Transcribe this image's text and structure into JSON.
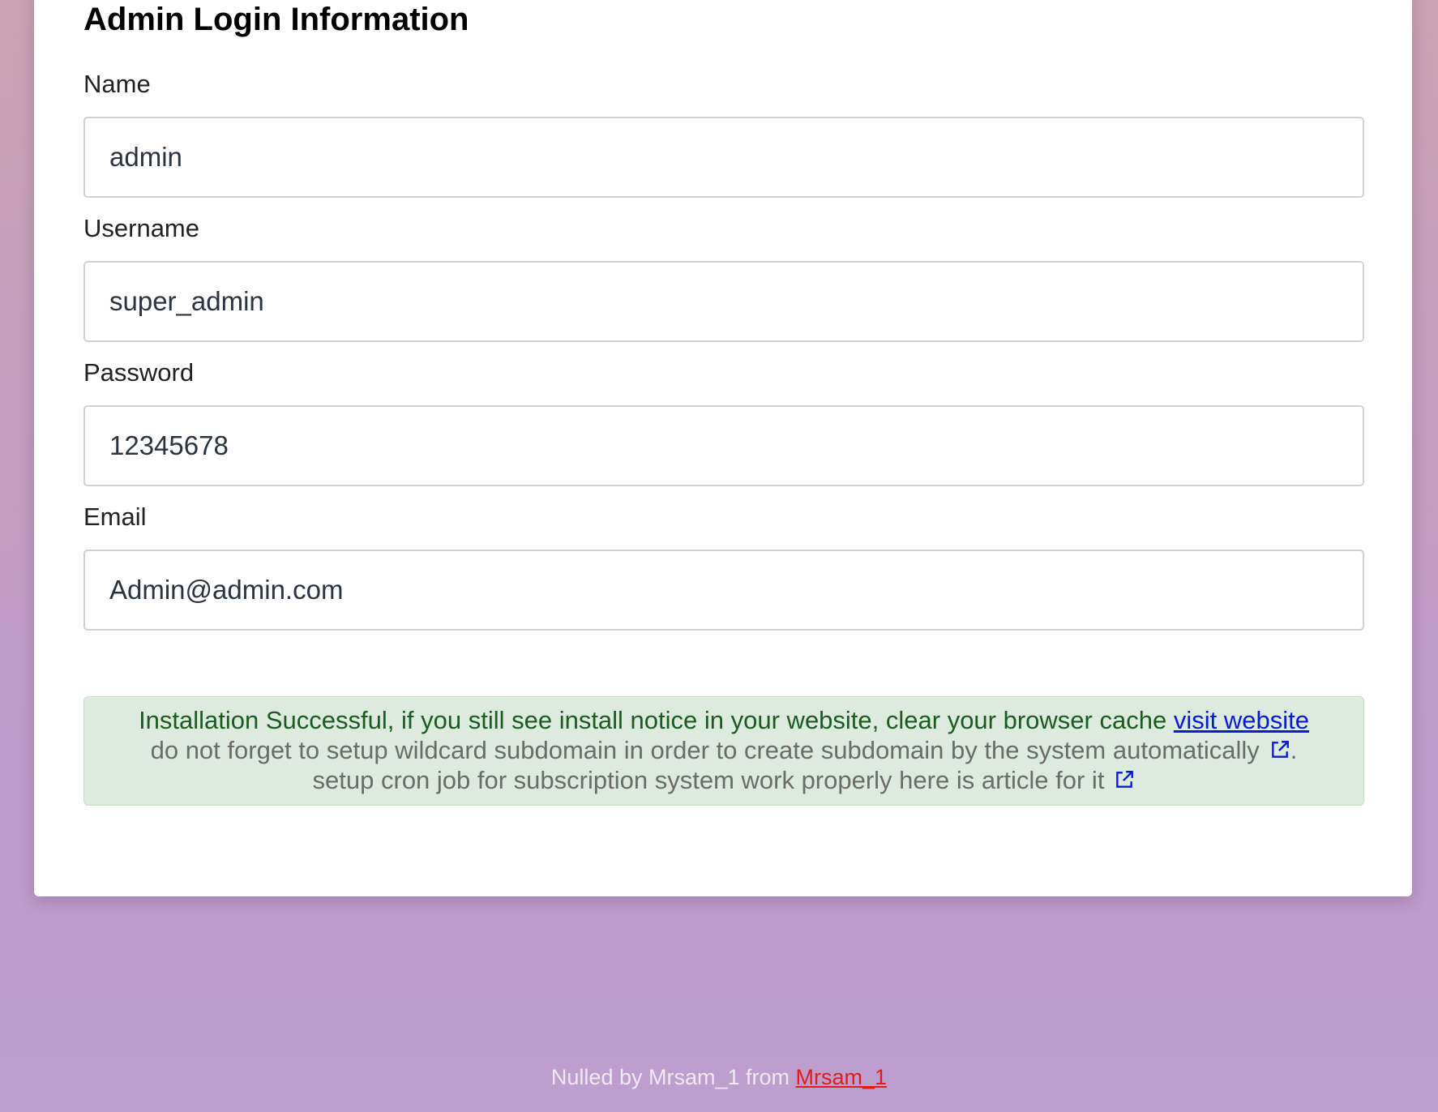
{
  "form": {
    "title": "Admin Login Information",
    "fields": [
      {
        "label": "Name",
        "value": "admin"
      },
      {
        "label": "Username",
        "value": "super_admin"
      },
      {
        "label": "Password",
        "value": "12345678"
      },
      {
        "label": "Email",
        "value": "Admin@admin.com"
      }
    ]
  },
  "alert": {
    "line1_text": "Installation Successful, if you still see install notice in your website, clear your browser cache",
    "line1_link": "visit website",
    "line2_text": "do not forget to setup wildcard subdomain in order to create subdomain by the system automatically",
    "line2_suffix": ".",
    "line3_text": "setup cron job for subscription system work properly here is article for it",
    "icon": "external-link-icon"
  },
  "footer": {
    "text": "Nulled by Mrsam_1 from",
    "link": "Mrsam_1"
  },
  "colors": {
    "success_text": "#1d5a22",
    "alert_background": "#dcebdd",
    "link": "#0a1ad6",
    "footer_link": "#e21b1b"
  }
}
